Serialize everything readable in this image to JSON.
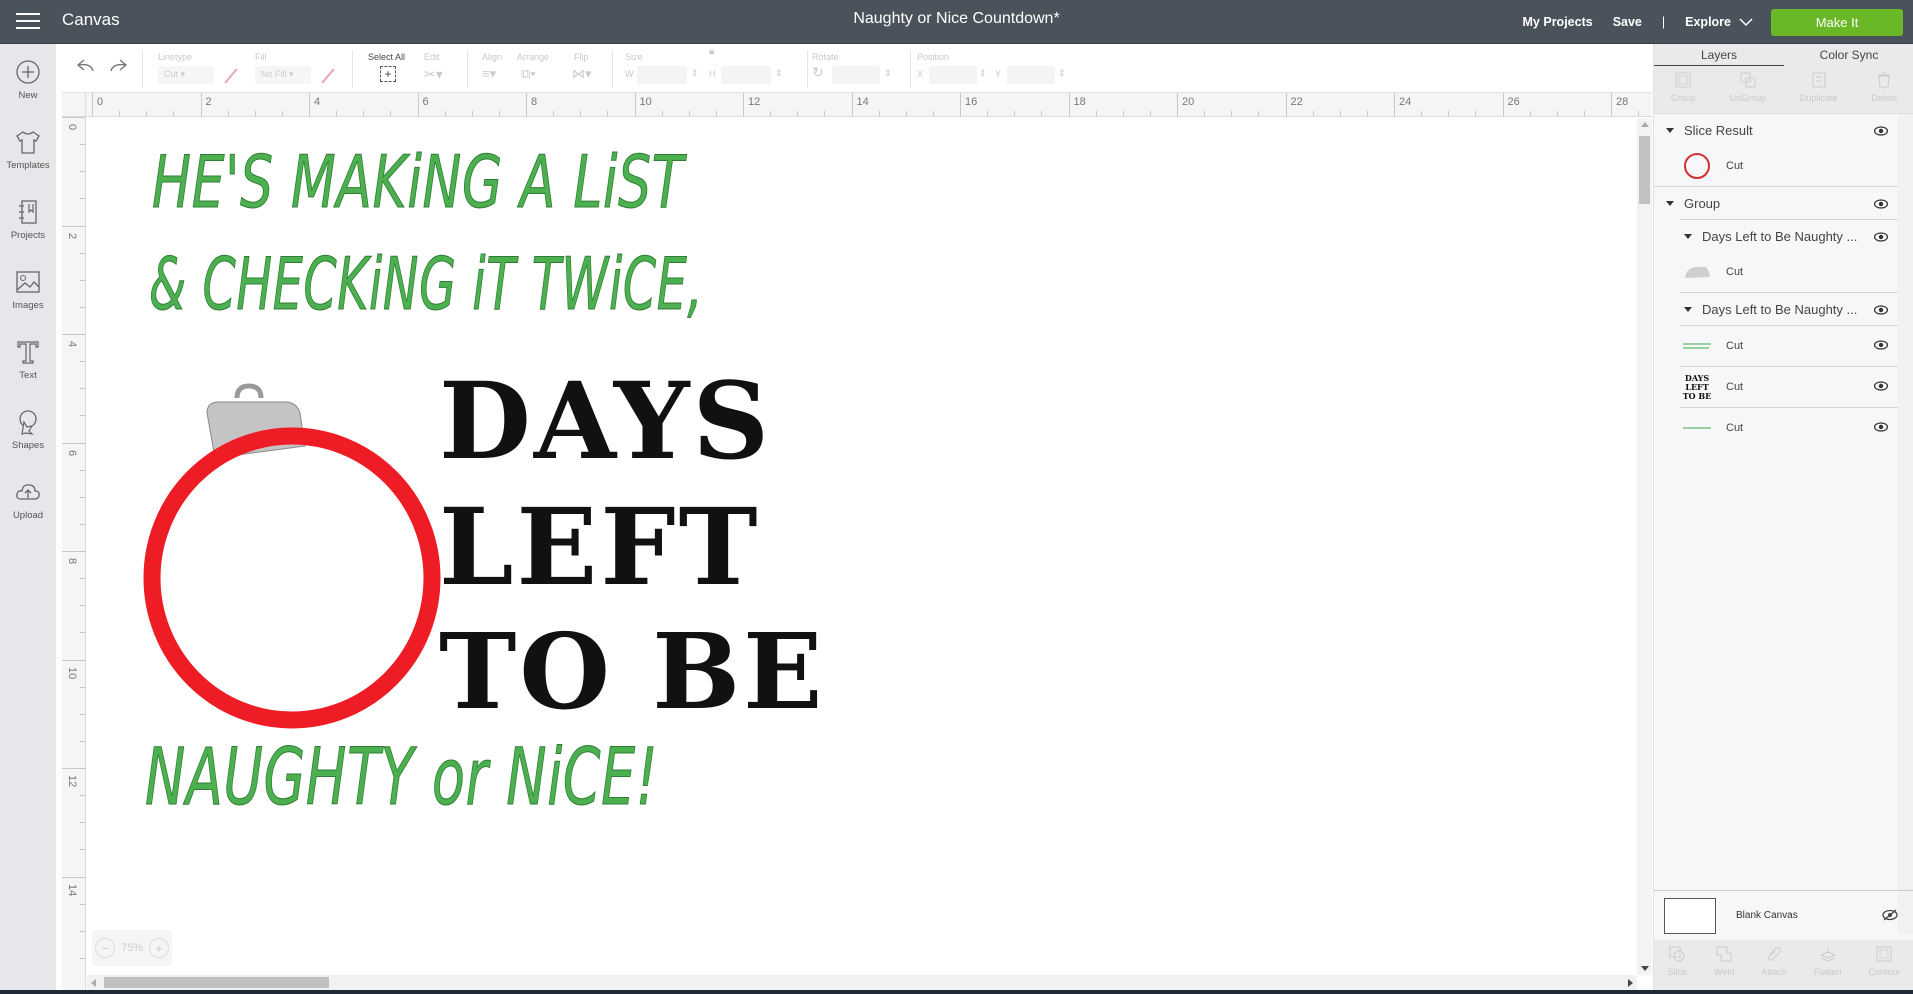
{
  "header": {
    "app_title": "Canvas",
    "document_title": "Naughty or Nice Countdown*",
    "my_projects": "My Projects",
    "save": "Save",
    "separator": "|",
    "explore": "Explore",
    "make_it": "Make It",
    "make_it_color": "#6ab825"
  },
  "leftnav": {
    "items": [
      {
        "label": "New",
        "icon": "plus-circle-icon"
      },
      {
        "label": "Templates",
        "icon": "tshirt-icon"
      },
      {
        "label": "Projects",
        "icon": "notebook-icon"
      },
      {
        "label": "Images",
        "icon": "image-icon"
      },
      {
        "label": "Text",
        "icon": "text-icon"
      },
      {
        "label": "Shapes",
        "icon": "shapes-icon"
      },
      {
        "label": "Upload",
        "icon": "cloud-upload-icon"
      }
    ]
  },
  "toolbar": {
    "linetype_label": "Linetype",
    "linetype_value": "Cut",
    "fill_label": "Fill",
    "fill_value": "No Fill",
    "select_all": "Select All",
    "edit": "Edit",
    "align": "Align",
    "arrange": "Arrange",
    "flip": "Flip",
    "size": "Size",
    "w": "W",
    "h": "H",
    "rotate": "Rotate",
    "position": "Position",
    "x": "X",
    "y": "Y"
  },
  "rulers": {
    "horizontal": [
      "0",
      "2",
      "4",
      "6",
      "8",
      "10",
      "12",
      "14",
      "16",
      "18",
      "20",
      "22",
      "24",
      "26",
      "28"
    ],
    "vertical": [
      "0",
      "2",
      "4",
      "6",
      "8",
      "10",
      "12",
      "14"
    ]
  },
  "canvas": {
    "line1": "HE'S MAKiNG A LiST",
    "line2": "& CHECKiNG iT TWiCE,",
    "days": "DAYS",
    "left": "LEFT",
    "tobe": "TO BE",
    "line_last": "NAUGHTY or NiCE!",
    "green": "#4caf50",
    "red": "#ee1c25",
    "zoom_level": "75%",
    "zoom_out": "−",
    "zoom_in": "+"
  },
  "panel": {
    "tabs": [
      "Layers",
      "Color Sync"
    ],
    "actions": [
      "Group",
      "UnGroup",
      "Duplicate",
      "Delete"
    ],
    "layers": [
      {
        "type": "group",
        "name": "Slice Result"
      },
      {
        "type": "item",
        "thumb": "red-ring",
        "op": "Cut"
      },
      {
        "type": "group",
        "name": "Group"
      },
      {
        "type": "subgroup",
        "name": "Days Left to Be Naughty ..."
      },
      {
        "type": "item",
        "thumb": "ornament-cap",
        "op": "Cut"
      },
      {
        "type": "subgroup",
        "name": "Days Left to Be Naughty ..."
      },
      {
        "type": "item",
        "thumb": "green-lines",
        "op": "Cut"
      },
      {
        "type": "item",
        "thumb": "days-left-text",
        "op": "Cut",
        "thumb_text": [
          "DAYS",
          "LEFT",
          "TO BE"
        ]
      },
      {
        "type": "item",
        "thumb": "green-line",
        "op": "Cut"
      }
    ],
    "blank_canvas": "Blank Canvas",
    "bottom_actions": [
      "Slice",
      "Weld",
      "Attach",
      "Flatten",
      "Contour"
    ]
  }
}
